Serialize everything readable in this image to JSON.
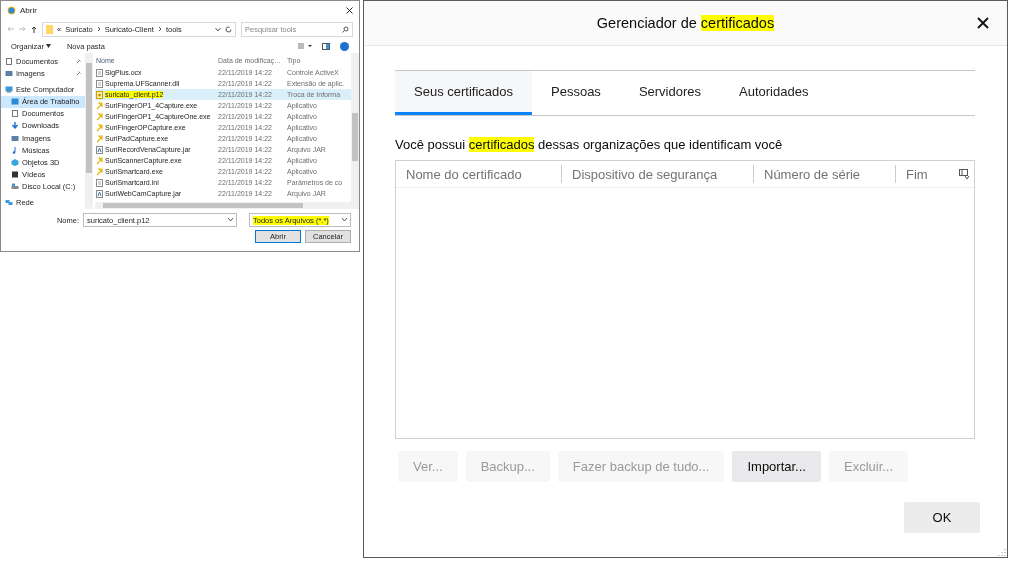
{
  "file_dialog": {
    "title": "Abrir",
    "path": [
      "«",
      "Suricato",
      "Suricato-Client",
      "tools"
    ],
    "search": {
      "placeholder": "Pesquisar tools"
    },
    "toolbar": {
      "organize": "Organizar",
      "new_folder": "Nova pasta"
    },
    "sidebar": {
      "items": [
        {
          "label": "Documentos",
          "pinned": true,
          "selected": false,
          "kind": "doc"
        },
        {
          "label": "Imagens",
          "pinned": true,
          "selected": false,
          "kind": "image"
        },
        {
          "label": "Este Computador",
          "pinned": false,
          "selected": false,
          "kind": "computer",
          "children": [
            {
              "label": "Área de Trabalho",
              "selected": true,
              "kind": "desktop"
            },
            {
              "label": "Documentos",
              "selected": false,
              "kind": "doc"
            },
            {
              "label": "Downloads",
              "selected": false,
              "kind": "download"
            },
            {
              "label": "Imagens",
              "selected": false,
              "kind": "image"
            },
            {
              "label": "Músicas",
              "selected": false,
              "kind": "music"
            },
            {
              "label": "Objetos 3D",
              "selected": false,
              "kind": "cube"
            },
            {
              "label": "Vídeos",
              "selected": false,
              "kind": "video"
            },
            {
              "label": "Disco Local (C:)",
              "selected": false,
              "kind": "drive"
            }
          ]
        },
        {
          "label": "Rede",
          "pinned": false,
          "selected": false,
          "kind": "network"
        }
      ]
    },
    "columns": [
      "Nome",
      "Data de modificaç…",
      "Tipo"
    ],
    "rows": [
      {
        "name": "SigPlus.ocx",
        "date": "22/11/2019 14:22",
        "type": "Controle ActiveX",
        "kind": "doc",
        "selected": false,
        "highlighted": false
      },
      {
        "name": "Suprema.UFScanner.dll",
        "date": "22/11/2019 14:22",
        "type": "Extensão de aplic.",
        "kind": "doc",
        "selected": false,
        "highlighted": false
      },
      {
        "name": "suricato_client.p12",
        "date": "22/11/2019 14:22",
        "type": "Troca de Informa",
        "kind": "cert",
        "selected": true,
        "highlighted": true
      },
      {
        "name": "SuriFingerOP1_4Capture.exe",
        "date": "22/11/2019 14:22",
        "type": "Aplicativo",
        "kind": "exe",
        "selected": false,
        "highlighted": false
      },
      {
        "name": "SuriFingerOP1_4CaptureOne.exe",
        "date": "22/11/2019 14:22",
        "type": "Aplicativo",
        "kind": "exe",
        "selected": false,
        "highlighted": false
      },
      {
        "name": "SuriFingerOPCapture.exe",
        "date": "22/11/2019 14:22",
        "type": "Aplicativo",
        "kind": "exe",
        "selected": false,
        "highlighted": false
      },
      {
        "name": "SuriPadCapture.exe",
        "date": "22/11/2019 14:22",
        "type": "Aplicativo",
        "kind": "exe",
        "selected": false,
        "highlighted": false
      },
      {
        "name": "SuriRecordVenaCapture.jar",
        "date": "22/11/2019 14:22",
        "type": "Arquivo JAR",
        "kind": "jar",
        "selected": false,
        "highlighted": false
      },
      {
        "name": "SuriScannerCapture.exe",
        "date": "22/11/2019 14:22",
        "type": "Aplicativo",
        "kind": "exe",
        "selected": false,
        "highlighted": false
      },
      {
        "name": "SuriSmartcard.exe",
        "date": "22/11/2019 14:22",
        "type": "Aplicativo",
        "kind": "exe",
        "selected": false,
        "highlighted": false
      },
      {
        "name": "SuriSmartcard.ini",
        "date": "22/11/2019 14:22",
        "type": "Parâmetros de co",
        "kind": "doc",
        "selected": false,
        "highlighted": false
      },
      {
        "name": "SuriWebCamCapture.jar",
        "date": "22/11/2019 14:22",
        "type": "Arquivo JAR",
        "kind": "jar",
        "selected": false,
        "highlighted": false
      }
    ],
    "name_label": "Nome:",
    "name_value": "suricato_client.p12",
    "filter": {
      "text": "Todos os Arquivos (*.*)",
      "highlighted": true
    },
    "buttons": [
      {
        "label": "Abrir",
        "default": true
      },
      {
        "label": "Cancelar",
        "default": false
      }
    ]
  },
  "cert_manager": {
    "title": [
      {
        "text": "Gerenciador de ",
        "highlighted": false
      },
      {
        "text": "certificados",
        "highlighted": true
      }
    ],
    "tabs": [
      {
        "label": "Seus certificados",
        "selected": true
      },
      {
        "label": "Pessoas",
        "selected": false
      },
      {
        "label": "Servidores",
        "selected": false
      },
      {
        "label": "Autoridades",
        "selected": false
      }
    ],
    "description": [
      {
        "text": "Você possui ",
        "highlighted": false
      },
      {
        "text": "certificados",
        "highlighted": true
      },
      {
        "text": " dessas organizações que identificam você",
        "highlighted": false
      }
    ],
    "table": {
      "columns": [
        "Nome do certificado",
        "Dispositivo de segurança",
        "Número de série",
        "Fim"
      ]
    },
    "buttons": [
      {
        "label": "Ver...",
        "disabled": true
      },
      {
        "label": "Backup...",
        "disabled": true
      },
      {
        "label": "Fazer backup de tudo...",
        "disabled": true
      },
      {
        "label": "Importar...",
        "disabled": false
      },
      {
        "label": "Excluir...",
        "disabled": true
      }
    ],
    "ok": "OK"
  }
}
